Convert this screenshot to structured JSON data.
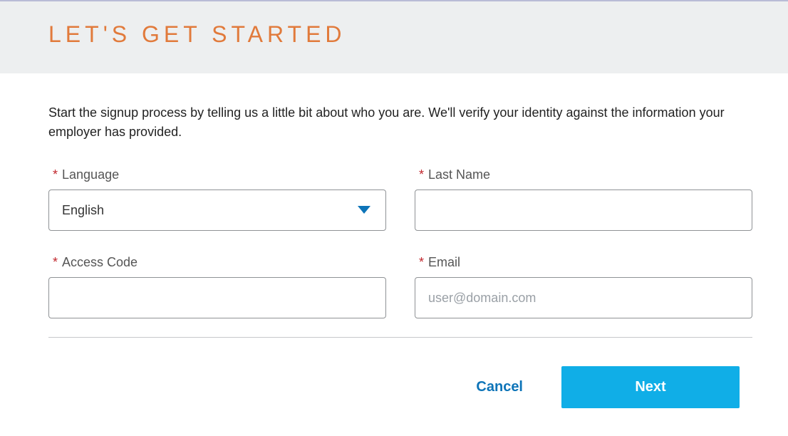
{
  "header": {
    "title": "LET'S GET STARTED"
  },
  "intro": "Start the signup process by telling us a little bit about who you are. We'll verify your identity against the information your employer has provided.",
  "fields": {
    "language": {
      "label": "Language",
      "value": "English"
    },
    "lastName": {
      "label": "Last Name",
      "value": ""
    },
    "accessCode": {
      "label": "Access Code",
      "value": ""
    },
    "email": {
      "label": "Email",
      "value": "",
      "placeholder": "user@domain.com"
    }
  },
  "actions": {
    "cancel": "Cancel",
    "next": "Next"
  }
}
